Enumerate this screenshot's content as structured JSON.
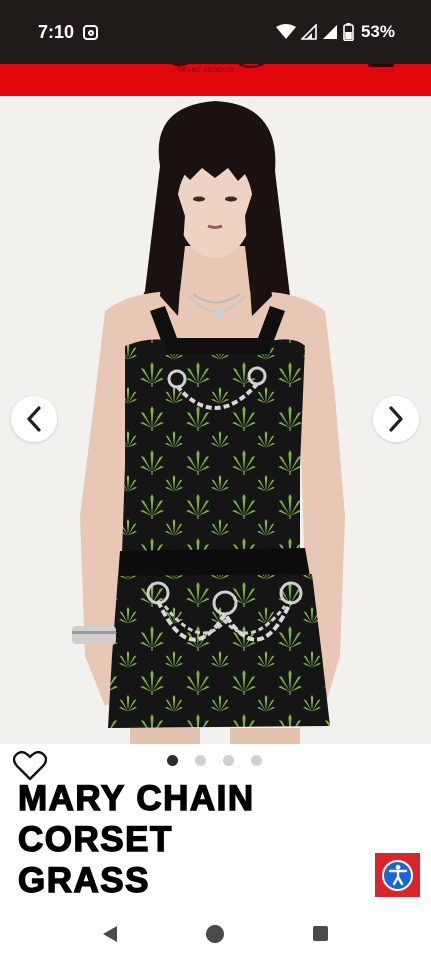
{
  "status_bar": {
    "time": "7:10",
    "battery": "53%",
    "icons": [
      "instagram-icon",
      "wifi-icon",
      "signal-icon",
      "signal-icon",
      "battery-icon"
    ]
  },
  "store_header": {
    "logo_text": "GRASS GOODIES",
    "menu": "menu-icon"
  },
  "gallery": {
    "total_images": 4,
    "current_image": 1,
    "prev": "chevron-left-icon",
    "next": "chevron-right-icon"
  },
  "product": {
    "title_lines": [
      "MARY CHAIN",
      "CORSET",
      "GRASS"
    ],
    "wishlist": "heart-icon"
  },
  "accessibility": {
    "icon": "accessibility-icon",
    "colors": {
      "button": "#d8242a",
      "circle": "#1a66d4"
    }
  },
  "system_nav": [
    "back-icon",
    "home-icon",
    "recents-icon"
  ],
  "colors": {
    "header": "#e0060b",
    "status_bar": "#201a18"
  }
}
